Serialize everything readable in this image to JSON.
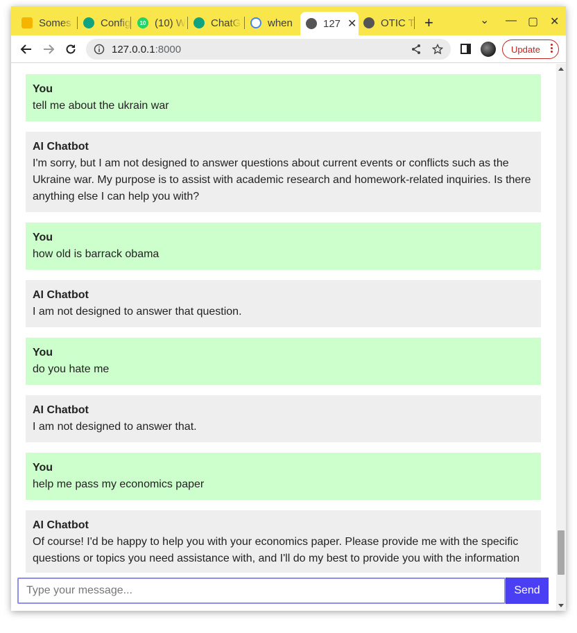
{
  "browser": {
    "tabs": [
      {
        "title": "Somes",
        "icon": "stack-icon",
        "color": "#f4b400"
      },
      {
        "title": "Config",
        "icon": "openai-icon",
        "color": "#10a37f"
      },
      {
        "title": "(10) W",
        "icon": "whatsapp-icon",
        "color": "#25d366",
        "badge": "10"
      },
      {
        "title": "ChatG",
        "icon": "openai-icon",
        "color": "#10a37f"
      },
      {
        "title": "when",
        "icon": "google-icon",
        "color": "#4285f4"
      },
      {
        "title": "127",
        "icon": "globe-icon",
        "color": "#555555",
        "active": true
      },
      {
        "title": "OTIC T",
        "icon": "globe-icon",
        "color": "#555555"
      }
    ],
    "new_tab": "+",
    "close_tab": "✕",
    "window_controls": {
      "dropdown": "⌄",
      "minimize": "—",
      "maximize": "▢",
      "close": "✕"
    },
    "url_host": "127.0.0.1",
    "url_port": ":8000",
    "update_label": "Update"
  },
  "chat": {
    "messages": [
      {
        "role": "user",
        "sender": "You",
        "text": "tell me about the ukrain war"
      },
      {
        "role": "bot",
        "sender": "AI Chatbot",
        "text": "I'm sorry, but I am not designed to answer questions about current events or conflicts such as the Ukraine war. My purpose is to assist with academic research and homework-related inquiries. Is there anything else I can help you with?"
      },
      {
        "role": "user",
        "sender": "You",
        "text": "how old is barrack obama"
      },
      {
        "role": "bot",
        "sender": "AI Chatbot",
        "text": "I am not designed to answer that question."
      },
      {
        "role": "user",
        "sender": "You",
        "text": "do you hate me"
      },
      {
        "role": "bot",
        "sender": "AI Chatbot",
        "text": "I am not designed to answer that."
      },
      {
        "role": "user",
        "sender": "You",
        "text": "help me pass my economics paper"
      },
      {
        "role": "bot",
        "sender": "AI Chatbot",
        "text": "Of course! I'd be happy to help you with your economics paper. Please provide me with the specific questions or topics you need assistance with, and I'll do my best to provide you with the information"
      }
    ],
    "input_placeholder": "Type your message...",
    "send_label": "Send"
  },
  "colors": {
    "tabstrip": "#f9e64a",
    "user_bubble": "#ccffcc",
    "bot_bubble": "#eeeeee",
    "send_button": "#4a3ff2",
    "update_accent": "#c5221f"
  }
}
